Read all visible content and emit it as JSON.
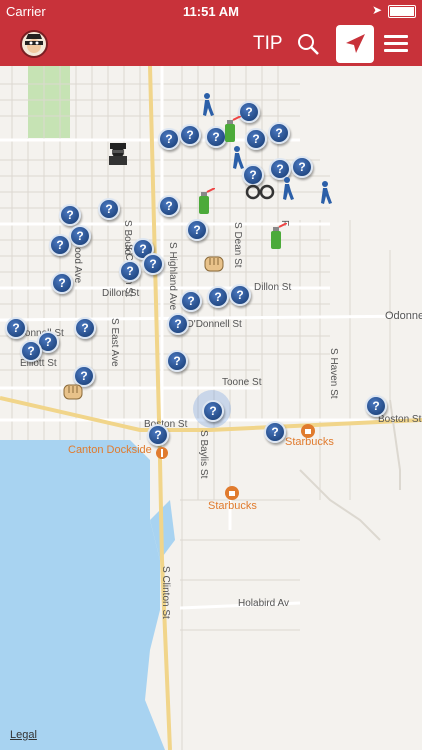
{
  "status_bar": {
    "carrier": "Carrier",
    "time": "11:51 AM"
  },
  "nav": {
    "tip_label": "TIP"
  },
  "map": {
    "streets": {
      "dillon": "Dillon St",
      "dillon_east": "Dillon St",
      "odonnell": "O'Donnell St",
      "odonnell_west": "O'Donnell St",
      "odonnell_east": "Odonne",
      "elliott": "Elliott St",
      "toone": "Toone St",
      "boston": "Boston St",
      "boston_east": "Boston St",
      "holabird": "Holabird Av",
      "s_dean": "S Dean St",
      "s_haven": "S Haven St",
      "s_baylis": "S Baylis St",
      "s_clinton": "S Clinton St",
      "s_clinton_north": "S Clinton St",
      "s_highland": "S Highland Ave",
      "s_east_ave": "S East Ave",
      "s_boulder": "S Bould",
      "s_wood": "wood Ave",
      "s_f": "F"
    },
    "pois": {
      "canton_dockside": "Canton Dockside",
      "starbucks_1": "Starbucks",
      "starbucks_2": "Starbucks"
    },
    "pin_symbol": "?",
    "legal": "Legal"
  }
}
